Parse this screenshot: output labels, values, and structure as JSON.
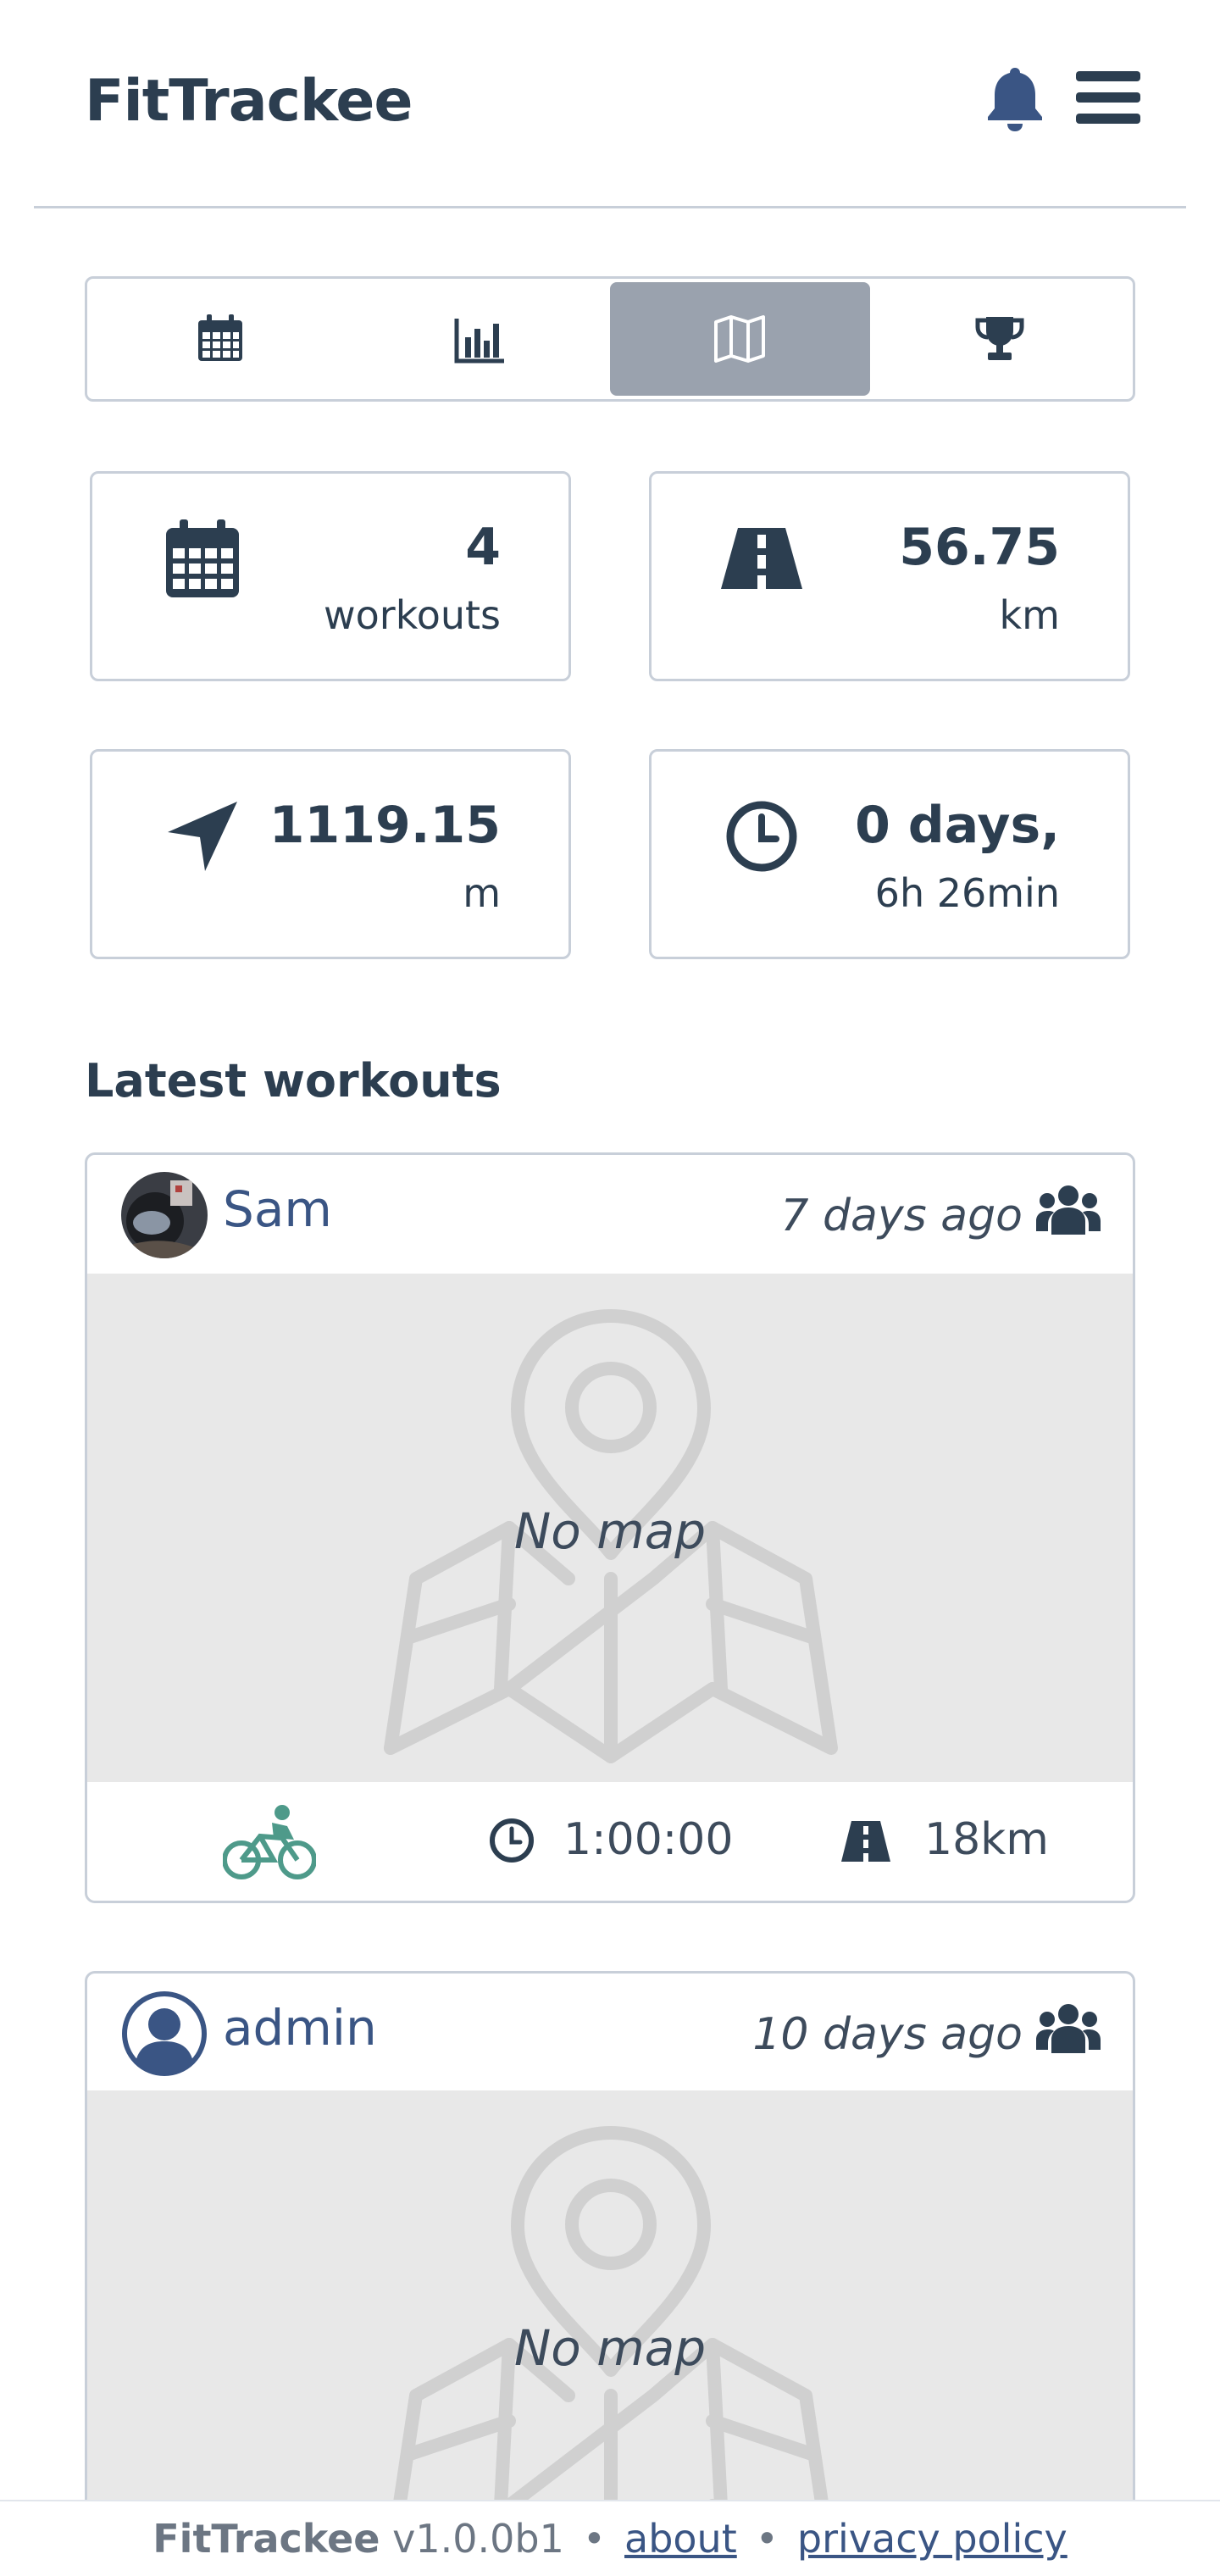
{
  "app": {
    "title": "FitTrackee"
  },
  "header": {
    "notifications_icon": "bell-icon",
    "menu_icon": "hamburger-icon"
  },
  "tabs": [
    {
      "name": "calendar",
      "icon": "calendar-icon",
      "active": false
    },
    {
      "name": "statistics",
      "icon": "chart-icon",
      "active": false
    },
    {
      "name": "map",
      "icon": "map-icon",
      "active": true
    },
    {
      "name": "records",
      "icon": "trophy-icon",
      "active": false
    }
  ],
  "stats": {
    "workouts": {
      "value": "4",
      "label": "workouts",
      "icon": "calendar-icon"
    },
    "distance": {
      "value": "56.75",
      "label": "km",
      "icon": "road-icon"
    },
    "ascent": {
      "value": "1119.15",
      "label": "m",
      "icon": "location-arrow-icon"
    },
    "duration": {
      "value": "0 days,",
      "label": "6h 26min",
      "icon": "clock-icon"
    }
  },
  "latest": {
    "title": "Latest workouts",
    "workouts": [
      {
        "user": "Sam",
        "ago": "7 days ago",
        "map_text": "No map",
        "sport_icon": "bike-icon",
        "duration": "1:00:00",
        "distance": "18km",
        "visibility_icon": "users-icon"
      },
      {
        "user": "admin",
        "ago": "10 days ago",
        "map_text": "No map",
        "visibility_icon": "users-icon"
      }
    ]
  },
  "footer": {
    "brand": "FitTrackee",
    "version": "v1.0.0b1",
    "sep": "•",
    "about": "about",
    "privacy": "privacy policy"
  },
  "colors": {
    "text": "#2c3e50",
    "link": "#3a5584",
    "active_tab": "#9aa2ae",
    "sport": "#4e9a8a",
    "map_bg": "#e8e8e8"
  }
}
